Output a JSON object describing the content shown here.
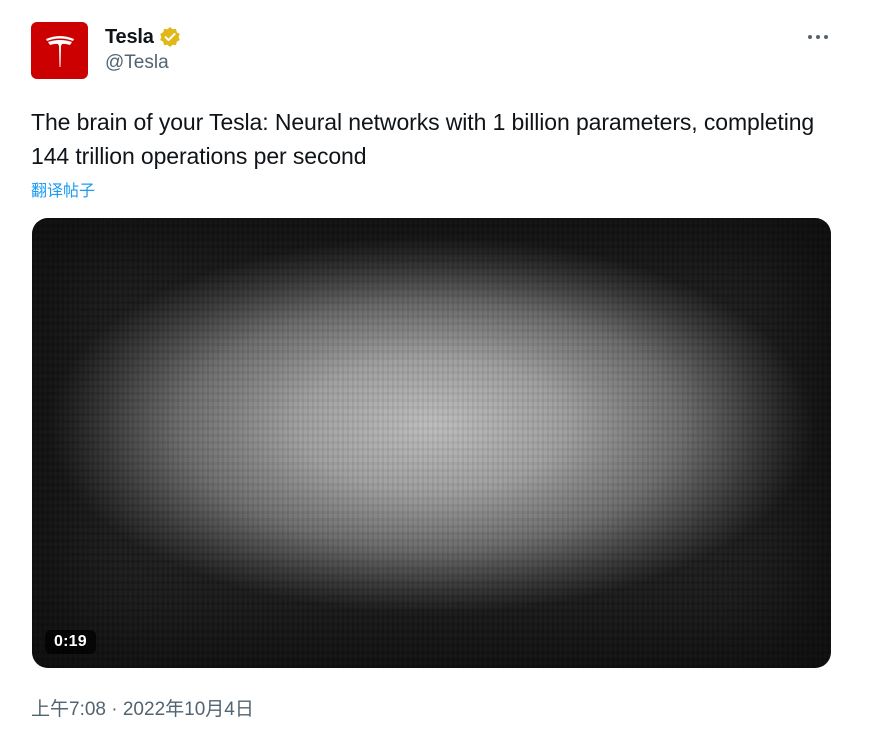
{
  "author": {
    "display_name": "Tesla",
    "handle": "@Tesla",
    "verified": true,
    "avatar_color": "#cc0000",
    "verified_badge_color": "#e2b719"
  },
  "tweet": {
    "text": "The brain of your Tesla: Neural networks with 1 billion parameters, completing 144 trillion operations per second",
    "translate_label": "翻译帖子",
    "timestamp": "上午7:08 · 2022年10月4日"
  },
  "media": {
    "type": "video",
    "duration": "0:19"
  },
  "icons": {
    "avatar": "tesla-logo-icon",
    "verified": "verified-badge-icon",
    "more": "more-options-icon"
  },
  "colors": {
    "link": "#1d9bf0",
    "secondary_text": "#536471",
    "primary_text": "#0f1419"
  }
}
